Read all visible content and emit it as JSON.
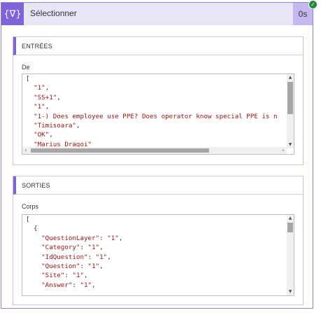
{
  "action": {
    "icon_name": "filter-array-icon",
    "icon_glyph": "{∇}",
    "title": "Sélectionner",
    "duration": "0s",
    "status": "succeeded",
    "status_glyph": "✓",
    "accent_color": "#8063d8"
  },
  "inputs": {
    "header": "ENTRÉES",
    "field_label": "De",
    "lines": [
      [
        {
          "t": "[",
          "c": "pun"
        }
      ],
      [
        {
          "t": "  ",
          "c": "pun"
        },
        {
          "t": "\"1\"",
          "c": "str"
        },
        {
          "t": ",",
          "c": "pun"
        }
      ],
      [
        {
          "t": "  ",
          "c": "pun"
        },
        {
          "t": "\"SS+1\"",
          "c": "str"
        },
        {
          "t": ",",
          "c": "pun"
        }
      ],
      [
        {
          "t": "  ",
          "c": "pun"
        },
        {
          "t": "\"1\"",
          "c": "str"
        },
        {
          "t": ",",
          "c": "pun"
        }
      ],
      [
        {
          "t": "  ",
          "c": "pun"
        },
        {
          "t": "\"1-) Does employee use PPE? Does operator know special PPE is n",
          "c": "str"
        }
      ],
      [
        {
          "t": "  ",
          "c": "pun"
        },
        {
          "t": "\"Timisoara\"",
          "c": "str"
        },
        {
          "t": ",",
          "c": "pun"
        }
      ],
      [
        {
          "t": "  ",
          "c": "pun"
        },
        {
          "t": "\"OK\"",
          "c": "str"
        },
        {
          "t": ",",
          "c": "pun"
        }
      ],
      [
        {
          "t": "  ",
          "c": "pun"
        },
        {
          "t": "\"Marius Dragoi\"",
          "c": "str"
        }
      ]
    ]
  },
  "outputs": {
    "header": "SORTIES",
    "field_label": "Corps",
    "lines": [
      [
        {
          "t": "[",
          "c": "pun"
        }
      ],
      [
        {
          "t": "  {",
          "c": "pun"
        }
      ],
      [
        {
          "t": "    ",
          "c": "pun"
        },
        {
          "t": "\"QuestionLayer\"",
          "c": "key"
        },
        {
          "t": ": ",
          "c": "pun"
        },
        {
          "t": "\"1\"",
          "c": "str"
        },
        {
          "t": ",",
          "c": "pun"
        }
      ],
      [
        {
          "t": "    ",
          "c": "pun"
        },
        {
          "t": "\"Category\"",
          "c": "key"
        },
        {
          "t": ": ",
          "c": "pun"
        },
        {
          "t": "\"1\"",
          "c": "str"
        },
        {
          "t": ",",
          "c": "pun"
        }
      ],
      [
        {
          "t": "    ",
          "c": "pun"
        },
        {
          "t": "\"IdQuestion\"",
          "c": "key"
        },
        {
          "t": ": ",
          "c": "pun"
        },
        {
          "t": "\"1\"",
          "c": "str"
        },
        {
          "t": ",",
          "c": "pun"
        }
      ],
      [
        {
          "t": "    ",
          "c": "pun"
        },
        {
          "t": "\"Question\"",
          "c": "key"
        },
        {
          "t": ": ",
          "c": "pun"
        },
        {
          "t": "\"1\"",
          "c": "str"
        },
        {
          "t": ",",
          "c": "pun"
        }
      ],
      [
        {
          "t": "    ",
          "c": "pun"
        },
        {
          "t": "\"Site\"",
          "c": "key"
        },
        {
          "t": ": ",
          "c": "pun"
        },
        {
          "t": "\"1\"",
          "c": "str"
        },
        {
          "t": ",",
          "c": "pun"
        }
      ],
      [
        {
          "t": "    ",
          "c": "pun"
        },
        {
          "t": "\"Answer\"",
          "c": "key"
        },
        {
          "t": ": ",
          "c": "pun"
        },
        {
          "t": "\"1\"",
          "c": "str"
        },
        {
          "t": ",",
          "c": "pun"
        }
      ]
    ]
  },
  "scroll_arrows": {
    "up": "▲",
    "down": "▼",
    "left": "‹",
    "right": "›"
  }
}
